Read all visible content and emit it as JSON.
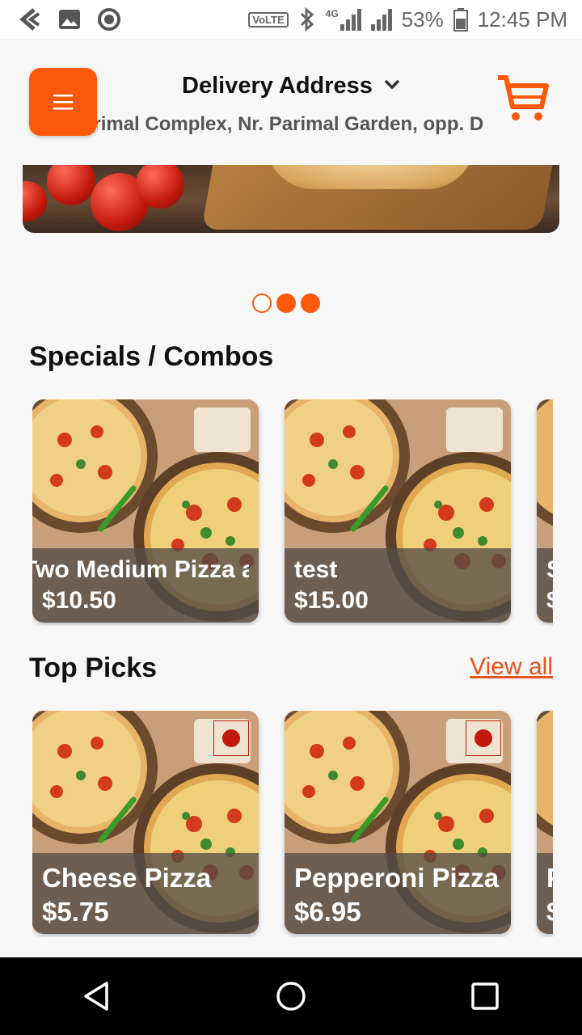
{
  "status_bar": {
    "volte": "VoLTE",
    "network": "4G",
    "battery": "53%",
    "time": "12:45 PM",
    "icons": [
      "back-arrow-icon",
      "image-icon",
      "circle-icon",
      "bluetooth-icon",
      "signal-icon",
      "battery-icon"
    ]
  },
  "header": {
    "menu_icon": "hamburger-icon",
    "title": "Delivery Address",
    "address": "Parimal Complex, Nr. Parimal Garden, opp. D",
    "cart_icon": "cart-icon"
  },
  "carousel": {
    "pages": 3,
    "active_index": 0
  },
  "specials": {
    "title": "Specials / Combos",
    "items": [
      {
        "name": "Two Medium Pizza and",
        "price": "$10.50"
      },
      {
        "name": "test",
        "price": "$15.00"
      },
      {
        "name": "S",
        "price": "$"
      }
    ]
  },
  "top_picks": {
    "title": "Top Picks",
    "view_all": "View all",
    "items": [
      {
        "name": "Cheese Pizza",
        "price": "$5.75"
      },
      {
        "name": "Pepperoni Pizza",
        "price": "$6.95"
      },
      {
        "name": "P",
        "price": "$"
      }
    ]
  },
  "colors": {
    "accent": "#fc5a0a",
    "veg_mark": "#c21a0a"
  }
}
